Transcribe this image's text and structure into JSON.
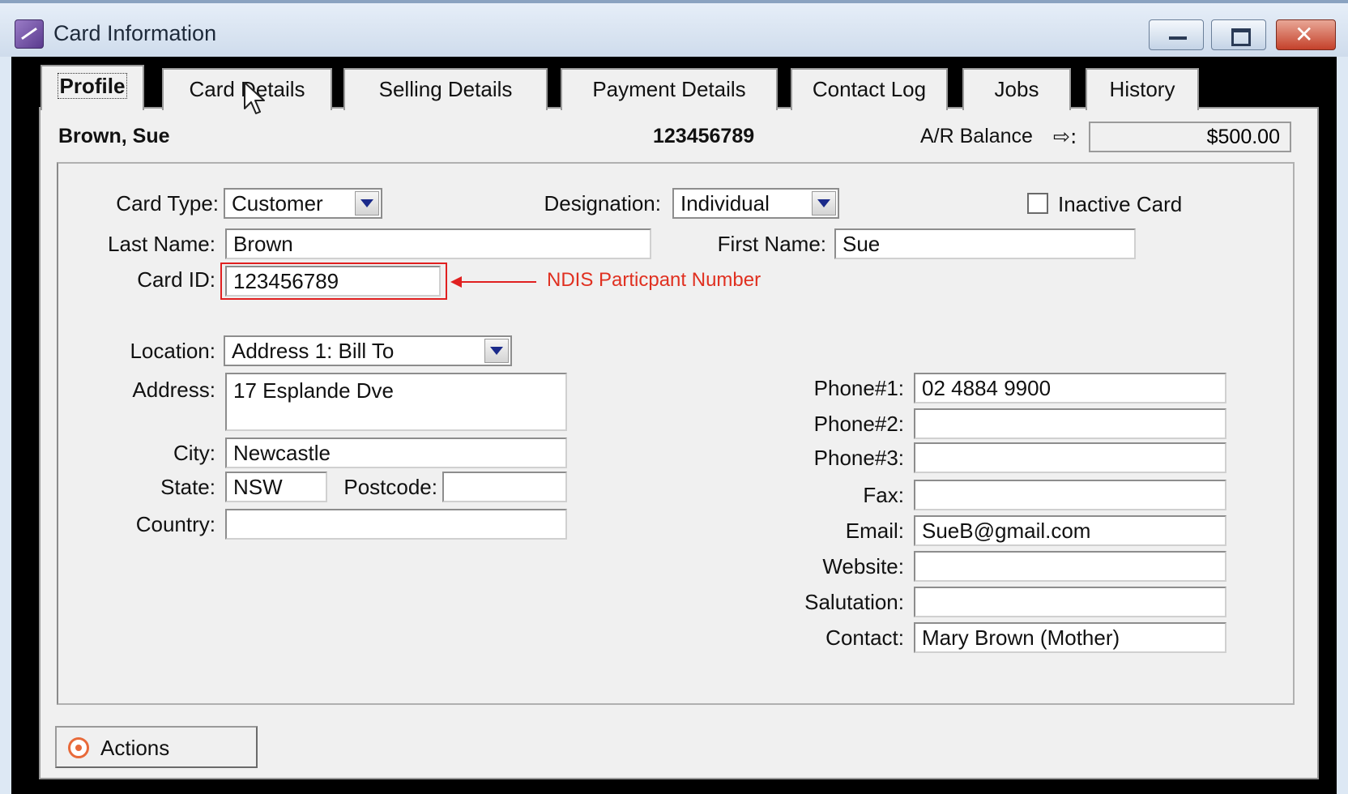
{
  "window": {
    "title": "Card Information"
  },
  "tabs": [
    "Profile",
    "Card Details",
    "Selling Details",
    "Payment Details",
    "Contact Log",
    "Jobs",
    "History"
  ],
  "active_tab": "Profile",
  "header": {
    "name": "Brown, Sue",
    "card_id": "123456789",
    "ar_label": "A/R Balance",
    "ar_suffix": ":",
    "ar_value": "$500.00"
  },
  "profile": {
    "card_type": {
      "label": "Card Type:",
      "value": "Customer"
    },
    "designation": {
      "label": "Designation:",
      "value": "Individual"
    },
    "inactive": {
      "label": "Inactive Card",
      "checked": false
    },
    "last_name": {
      "label": "Last Name:",
      "value": "Brown"
    },
    "first_name": {
      "label": "First Name:",
      "value": "Sue"
    },
    "card_id": {
      "label": "Card ID:",
      "value": "123456789"
    },
    "annotation": "NDIS Particpant Number",
    "location": {
      "label": "Location:",
      "value": "Address 1:  Bill To"
    },
    "address": {
      "label": "Address:",
      "value": "17 Esplande Dve"
    },
    "city": {
      "label": "City:",
      "value": "Newcastle"
    },
    "state": {
      "label": "State:",
      "value": "NSW"
    },
    "postcode": {
      "label": "Postcode:",
      "value": ""
    },
    "country": {
      "label": "Country:",
      "value": ""
    },
    "phone1": {
      "label": "Phone#1:",
      "value": "02 4884 9900"
    },
    "phone2": {
      "label": "Phone#2:",
      "value": ""
    },
    "phone3": {
      "label": "Phone#3:",
      "value": ""
    },
    "fax": {
      "label": "Fax:",
      "value": ""
    },
    "email": {
      "label": "Email:",
      "value": "SueB@gmail.com"
    },
    "website": {
      "label": "Website:",
      "value": ""
    },
    "salutation": {
      "label": "Salutation:",
      "value": ""
    },
    "contact": {
      "label": "Contact:",
      "value": "Mary Brown (Mother)"
    }
  },
  "actions": {
    "label": "Actions"
  },
  "icons": {
    "app": "card-app-icon",
    "minimize": "minimize-icon",
    "maximize": "maximize-icon",
    "close": "close-icon",
    "ar_arrow": "arrow-right-icon",
    "actions": "target-icon",
    "cursor": "mouse-cursor-icon"
  },
  "colors": {
    "annotation": "#e02020",
    "titlebar": "#dde8f4",
    "close_button": "#c4412b"
  }
}
